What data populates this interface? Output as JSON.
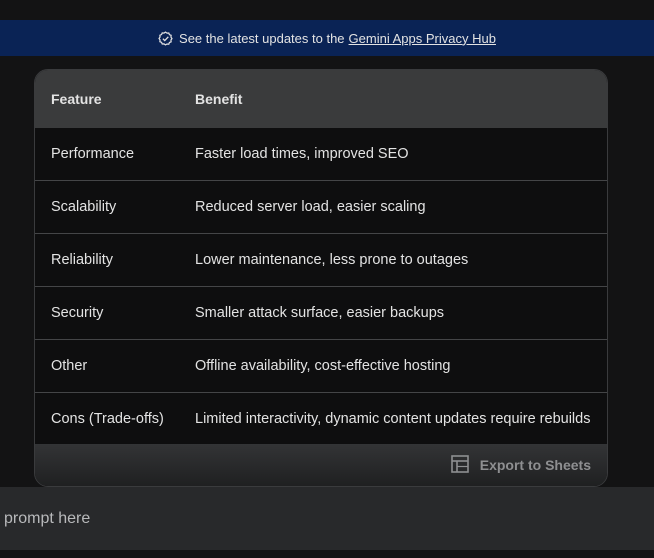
{
  "banner": {
    "prefix": "See the latest updates to the",
    "link": "Gemini Apps Privacy Hub"
  },
  "table": {
    "headers": [
      "Feature",
      "Benefit"
    ],
    "rows": [
      [
        "Performance",
        "Faster load times, improved SEO"
      ],
      [
        "Scalability",
        "Reduced server load, easier scaling"
      ],
      [
        "Reliability",
        "Lower maintenance, less prone to outages"
      ],
      [
        "Security",
        "Smaller attack surface, easier backups"
      ],
      [
        "Other",
        "Offline availability, cost-effective hosting"
      ],
      [
        "Cons (Trade-offs)",
        "Limited interactivity, dynamic content updates require rebuilds"
      ]
    ],
    "export_label": "Export to Sheets"
  },
  "prompt": {
    "placeholder": "prompt here"
  }
}
